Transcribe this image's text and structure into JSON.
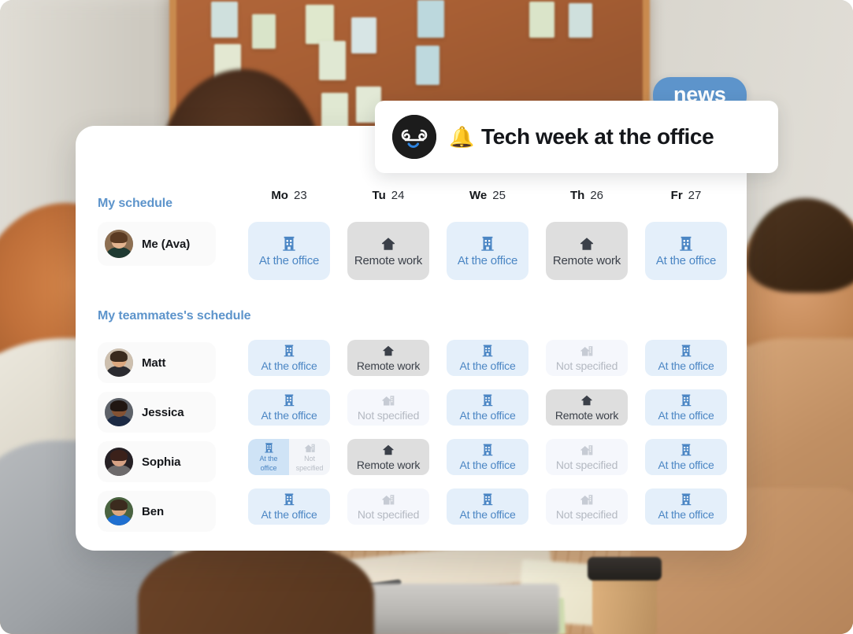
{
  "news": {
    "badge_label": "news",
    "logo_icon": "company-face-logo",
    "bell_icon": "🔔",
    "headline": "Tech week at the office"
  },
  "card": {
    "my_schedule_title": "My schedule",
    "teammates_title": "My teammates's schedule",
    "days": [
      {
        "dow": "Mo",
        "date": "23"
      },
      {
        "dow": "Tu",
        "date": "24"
      },
      {
        "dow": "We",
        "date": "25"
      },
      {
        "dow": "Th",
        "date": "26"
      },
      {
        "dow": "Fr",
        "date": "27"
      }
    ],
    "status_labels": {
      "office": "At the office",
      "remote": "Remote work",
      "unspecified": "Not specified",
      "office_short_line1": "At the",
      "office_short_line2": "office",
      "unspecified_short_line1": "Not",
      "unspecified_short_line2": "specified"
    },
    "me": {
      "name": "Me (Ava)",
      "avatar_icon": "avatar-ava",
      "schedule": [
        {
          "status": "office",
          "label": "At the office"
        },
        {
          "status": "remote",
          "label": "Remote work"
        },
        {
          "status": "office",
          "label": "At the office"
        },
        {
          "status": "remote",
          "label": "Remote work"
        },
        {
          "status": "office",
          "label": "At the office"
        }
      ]
    },
    "teammates": [
      {
        "name": "Matt",
        "avatar_icon": "avatar-matt",
        "schedule": [
          {
            "status": "office",
            "label": "At the office"
          },
          {
            "status": "remote",
            "label": "Remote work"
          },
          {
            "status": "office",
            "label": "At the office"
          },
          {
            "status": "unspecified",
            "label": "Not specified"
          },
          {
            "status": "office",
            "label": "At the office"
          }
        ]
      },
      {
        "name": "Jessica",
        "avatar_icon": "avatar-jessica",
        "schedule": [
          {
            "status": "office",
            "label": "At the office"
          },
          {
            "status": "unspecified",
            "label": "Not specified"
          },
          {
            "status": "office",
            "label": "At the office"
          },
          {
            "status": "remote",
            "label": "Remote work"
          },
          {
            "status": "office",
            "label": "At the office"
          }
        ]
      },
      {
        "name": "Sophia",
        "avatar_icon": "avatar-sophia",
        "schedule": [
          {
            "status": "split",
            "halves": [
              {
                "status": "office",
                "line1": "At the",
                "line2": "office"
              },
              {
                "status": "unspecified",
                "line1": "Not",
                "line2": "specified"
              }
            ]
          },
          {
            "status": "remote",
            "label": "Remote work"
          },
          {
            "status": "office",
            "label": "At the office"
          },
          {
            "status": "unspecified",
            "label": "Not specified"
          },
          {
            "status": "office",
            "label": "At the office"
          }
        ]
      },
      {
        "name": "Ben",
        "avatar_icon": "avatar-ben",
        "schedule": [
          {
            "status": "office",
            "label": "At the office"
          },
          {
            "status": "unspecified",
            "label": "Not specified"
          },
          {
            "status": "office",
            "label": "At the office"
          },
          {
            "status": "unspecified",
            "label": "Not specified"
          },
          {
            "status": "office",
            "label": "At the office"
          }
        ]
      }
    ]
  },
  "colors": {
    "accent_blue": "#5d94cb",
    "office_bg": "#e4effa",
    "office_text": "#4b86c4",
    "remote_bg": "#dedede",
    "remote_text": "#3b4049",
    "unspecified_bg": "#f5f7fc",
    "unspecified_text": "#b4b9c2",
    "card_bg": "#ffffff",
    "logo_bg": "#1c1c1c"
  }
}
